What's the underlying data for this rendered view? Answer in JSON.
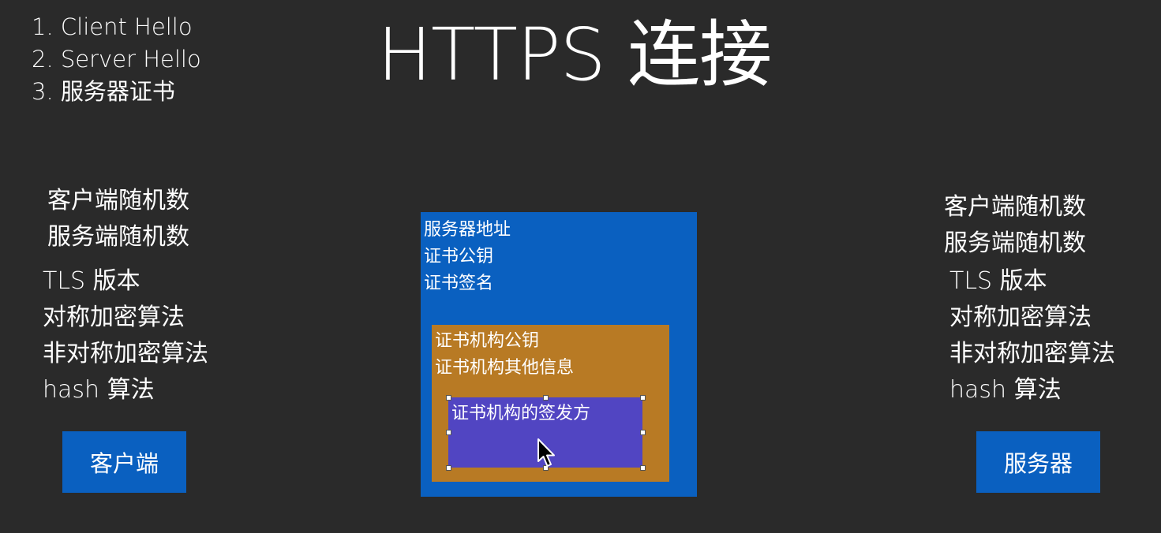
{
  "title": "HTTPS 连接",
  "steps": [
    "1. Client Hello",
    "2. Server Hello",
    "3. 服务器证书"
  ],
  "client": {
    "randoms": [
      "客户端随机数",
      "服务端随机数"
    ],
    "params": [
      "TLS 版本",
      "对称加密算法",
      "非对称加密算法",
      "hash 算法"
    ],
    "box_label": "客户端"
  },
  "server": {
    "randoms": [
      "客户端随机数",
      "服务端随机数"
    ],
    "params": [
      "TLS 版本",
      "对称加密算法",
      "非对称加密算法",
      "hash 算法"
    ],
    "box_label": "服务器"
  },
  "certificate": {
    "lines": [
      "服务器地址",
      "证书公钥",
      "证书签名"
    ],
    "ca": {
      "lines": [
        "证书机构公钥",
        "证书机构其他信息"
      ],
      "issuer": "证书机构的签发方"
    }
  },
  "colors": {
    "background": "#2a2a2a",
    "blue": "#0a60c0",
    "orange": "#b87a24",
    "purple": "#5145c2"
  },
  "icons": {
    "cursor": "arrow-cursor-icon"
  }
}
